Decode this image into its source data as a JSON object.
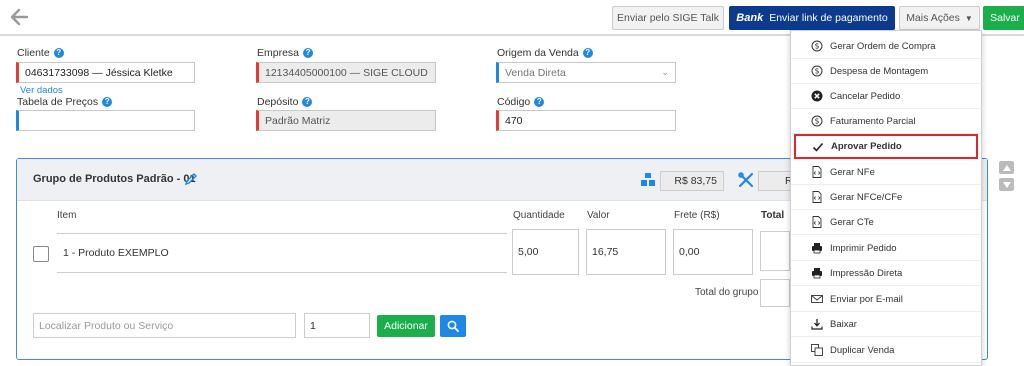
{
  "toolbar": {
    "talk_label": "Enviar pelo SIGE Talk",
    "bank_brand": "Bank",
    "bank_label": "Enviar link de pagamento",
    "mais_label": "Mais Ações",
    "salvar_label": "Salvar"
  },
  "form": {
    "cliente_label": "Cliente",
    "cliente_value": "04631733098 — Jéssica Kletke",
    "ver_dados": "Ver dados",
    "empresa_label": "Empresa",
    "empresa_value": "12134405000100 — SIGE CLOUD",
    "origem_label": "Origem da Venda",
    "origem_value": "Venda Direta",
    "tabela_label": "Tabela de Preços",
    "tabela_value": "",
    "deposito_label": "Depósito",
    "deposito_value": "Padrão Matriz",
    "codigo_label": "Código",
    "codigo_value": "470"
  },
  "group": {
    "title": "Grupo de Produtos Padrão - 01",
    "products_total": "R$ 83,75",
    "services_total": "R",
    "columns": {
      "item": "Item",
      "quantidade": "Quantidade",
      "valor": "Valor",
      "frete": "Frete (R$)",
      "total": "Total"
    },
    "row": {
      "item": "1 - Produto EXEMPLO",
      "quantidade": "5,00",
      "valor": "16,75",
      "frete": "0,00"
    },
    "total_grupo_label": "Total do grupo",
    "search_placeholder": "Localizar Produto ou Serviço",
    "qty_value": "1",
    "add_label": "Adicionar"
  },
  "menu": {
    "items": [
      {
        "label": "Gerar Ordem de Compra",
        "icon": "dollar-circle-icon"
      },
      {
        "label": "Despesa de Montagem",
        "icon": "dollar-circle-icon"
      },
      {
        "label": "Cancelar Pedido",
        "icon": "cancel-circle-icon"
      },
      {
        "label": "Faturamento Parcial",
        "icon": "dollar-circle-icon"
      },
      {
        "label": "Aprovar Pedido",
        "icon": "check-icon"
      },
      {
        "label": "Gerar NFe",
        "icon": "code-file-icon"
      },
      {
        "label": "Gerar NFCe/CFe",
        "icon": "code-file-icon"
      },
      {
        "label": "Gerar CTe",
        "icon": "code-file-icon"
      },
      {
        "label": "Imprimir Pedido",
        "icon": "printer-icon"
      },
      {
        "label": "Impressão Direta",
        "icon": "printer-icon"
      },
      {
        "label": "Enviar por E-mail",
        "icon": "envelope-icon"
      },
      {
        "label": "Baixar",
        "icon": "download-icon"
      },
      {
        "label": "Duplicar Venda",
        "icon": "duplicate-icon"
      }
    ]
  },
  "colors": {
    "accent": "#1e88e5",
    "success": "#1aaf4b",
    "bank": "#0b3a8f",
    "required": "#e53935",
    "highlight": "#e0262b"
  }
}
